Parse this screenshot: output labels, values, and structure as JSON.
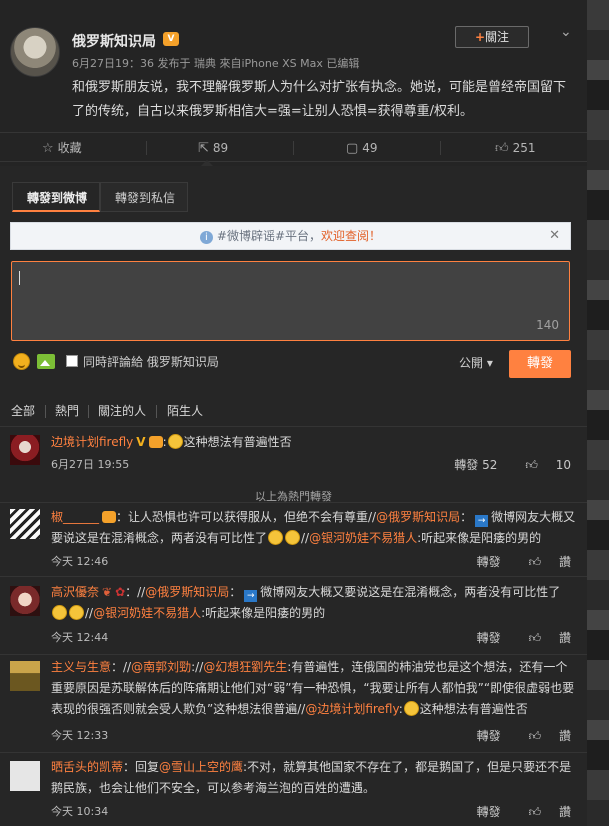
{
  "post": {
    "author": "俄罗斯知识局",
    "meta": "6月27日19：36 发布于 瑞典 來自iPhone XS Max  已编辑",
    "follow_label": "關注",
    "text": "和俄罗斯朋友说，我不理解俄罗斯人为什么对扩张有执念。她说，可能是曾经帝国留下了的传统，自古以来俄罗斯相信大=强=让别人恐惧=获得尊重/权利。"
  },
  "actions": {
    "collect": "收藏",
    "repost_count": "89",
    "comment_count": "49",
    "like_count": "251"
  },
  "panel": {
    "tab_weibo": "轉發到微博",
    "tab_message": "轉發到私信",
    "notice_prefix": "#微博辟谣#平台，",
    "notice_link": "欢迎查阅！",
    "char_count": "140",
    "also_comment": "同時評論給 俄罗斯知识局",
    "visibility": "公開 ▾",
    "submit": "轉發"
  },
  "filters": [
    "全部",
    "熱門",
    "關注的人",
    "陌生人"
  ],
  "hot_divider": "以上為熱門轉發",
  "reposts": [
    {
      "user": "边境计划firefly",
      "segments": [
        {
          "t": ":"
        },
        {
          "emo": true
        },
        {
          "t": "这种想法有普遍性否"
        }
      ],
      "time": "6月27日 19:55",
      "repost": "轉發 52",
      "like": "10"
    },
    {
      "user": "椒______",
      "text_a": "：让人恐惧也许可以获得服从，但绝不会有尊重//",
      "at1": "@俄罗斯知识局",
      "text_b": "：",
      "text_c": "微博网友大概又要说这是在混淆概念，两者没有可比性了",
      "text_d": "//",
      "at2": "@银河奶娃不易猎人",
      "text_e": ":听起来像是阳痿的男的",
      "time": "今天 12:46",
      "repost": "轉發",
      "like": "讚"
    },
    {
      "user": "高沢優奈",
      "text_a": "：//",
      "at1": "@俄罗斯知识局",
      "text_b": "：",
      "text_c": "微博网友大概又要说这是在混淆概念，两者没有可比性了",
      "text_d": "//",
      "at2": "@银河奶娃不易猎人",
      "text_e": ":听起来像是阳痿的男的",
      "time": "今天 12:44",
      "repost": "轉發",
      "like": "讚"
    },
    {
      "user": "主义与生意",
      "text_a": "：//",
      "at1": "@南郭刘勁",
      "text_b": "://",
      "at2": "@幻想狂劉先生",
      "text_c": ":有普遍性，连俄国的柿油党也是这个想法，还有一个重要原因是苏联解体后的阵痛期让他们对“弱”有一种恐惧，“我要让所有人都怕我”“即使很虚弱也要表现的很强否则就会受人欺负”这种想法很普遍//",
      "at3": "@边境计划firefly",
      "text_d": ":",
      "text_e": "这种想法有普遍性否",
      "time": "今天 12:33",
      "repost": "轉發",
      "like": "讚"
    },
    {
      "user": "晒舌头的凯蒂",
      "text_a": "：回复",
      "at1": "@雪山上空的鹰",
      "text_b": ":不对，就算其他国家不存在了，都是鹅国了，但是只要还不是鹅民族，也会让他们不安全，可以参考海兰泡的百姓的遭遇。",
      "time": "今天 10:34",
      "repost": "轉發",
      "like": "讚"
    }
  ]
}
